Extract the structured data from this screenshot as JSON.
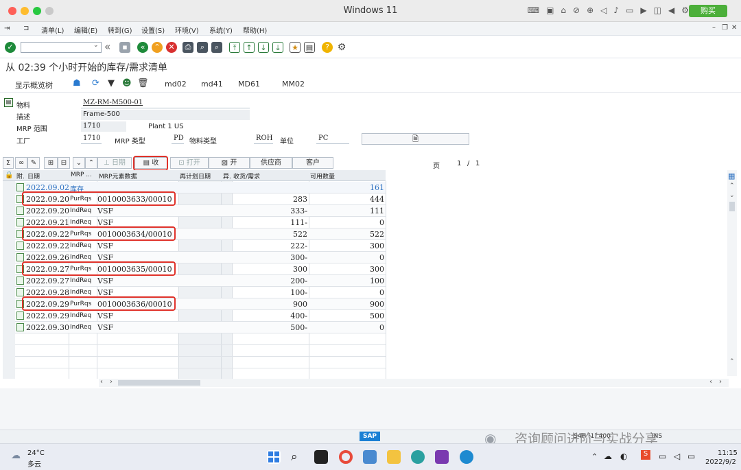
{
  "window": {
    "title": "Windows 11",
    "buy_label": "购买"
  },
  "menu": [
    "清单(L)",
    "编辑(E)",
    "转到(G)",
    "设置(S)",
    "环境(V)",
    "系统(Y)",
    "帮助(H)"
  ],
  "page_title": "从 02:39 个小时开始的库存/需求清单",
  "app_toolbar": {
    "overview_tree": "显示概览树",
    "links": [
      "md02",
      "md41",
      "MD61",
      "MM02"
    ]
  },
  "header": {
    "material_label": "物料",
    "material_value": "MZ-RM-M500-01",
    "desc_label": "描述",
    "desc_value": "Frame-500",
    "mrp_area_label": "MRP 范围",
    "mrp_area_value": "1710",
    "mrp_area_text": "Plant 1 US",
    "plant_label": "工厂",
    "plant_value": "1710",
    "mrp_type_label": "MRP 类型",
    "mrp_type_value": "PD",
    "mat_type_label": "物料类型",
    "mat_type_value": "ROH",
    "unit_label": "单位",
    "unit_value": "PC"
  },
  "grid_toolbar": {
    "date_label": "日期",
    "receipt_label": "收",
    "open_label": "打开",
    "on_label": "开",
    "vendor_label": "供应商",
    "customer_label": "客户",
    "page_label": "页",
    "page_current": "1",
    "page_sep": "/",
    "page_total": "1"
  },
  "grid": {
    "headers": [
      "附.",
      "日期",
      "MRP ...",
      "MRP元素数据",
      "再计划日期",
      "异.",
      "收货/需求",
      "可用数量"
    ],
    "stock_row": {
      "date": "2022.09.02",
      "mrp": "库存",
      "avail": "161"
    },
    "rows": [
      {
        "date": "2022.09.20",
        "mrp": "PurRqs",
        "elem": "0010003633/00010",
        "qty": "283",
        "avail": "444"
      },
      {
        "date": "2022.09.20",
        "mrp": "IndReq",
        "elem": "VSF",
        "qty": "333-",
        "avail": "111"
      },
      {
        "date": "2022.09.21",
        "mrp": "IndReq",
        "elem": "VSF",
        "qty": "111-",
        "avail": "0"
      },
      {
        "date": "2022.09.22",
        "mrp": "PurRqs",
        "elem": "0010003634/00010",
        "qty": "522",
        "avail": "522"
      },
      {
        "date": "2022.09.22",
        "mrp": "IndReq",
        "elem": "VSF",
        "qty": "222-",
        "avail": "300"
      },
      {
        "date": "2022.09.26",
        "mrp": "IndReq",
        "elem": "VSF",
        "qty": "300-",
        "avail": "0"
      },
      {
        "date": "2022.09.27",
        "mrp": "PurRqs",
        "elem": "0010003635/00010",
        "qty": "300",
        "avail": "300"
      },
      {
        "date": "2022.09.27",
        "mrp": "IndReq",
        "elem": "VSF",
        "qty": "200-",
        "avail": "100"
      },
      {
        "date": "2022.09.28",
        "mrp": "IndReq",
        "elem": "VSF",
        "qty": "100-",
        "avail": "0"
      },
      {
        "date": "2022.09.29",
        "mrp": "PurRqs",
        "elem": "0010003636/00010",
        "qty": "900",
        "avail": "900"
      },
      {
        "date": "2022.09.29",
        "mrp": "IndReq",
        "elem": "VSF",
        "qty": "400-",
        "avail": "500"
      },
      {
        "date": "2022.09.30",
        "mrp": "IndReq",
        "elem": "VSF",
        "qty": "500-",
        "avail": "0"
      }
    ]
  },
  "status": {
    "sap_logo": "SAP",
    "session": "S4H (1) 400",
    "mode": "INS"
  },
  "watermark": "咨询顾问进阶与实战分享",
  "taskbar": {
    "temp": "24°C",
    "weather": "多云",
    "time": "11:15",
    "date": "2022/9/2"
  }
}
